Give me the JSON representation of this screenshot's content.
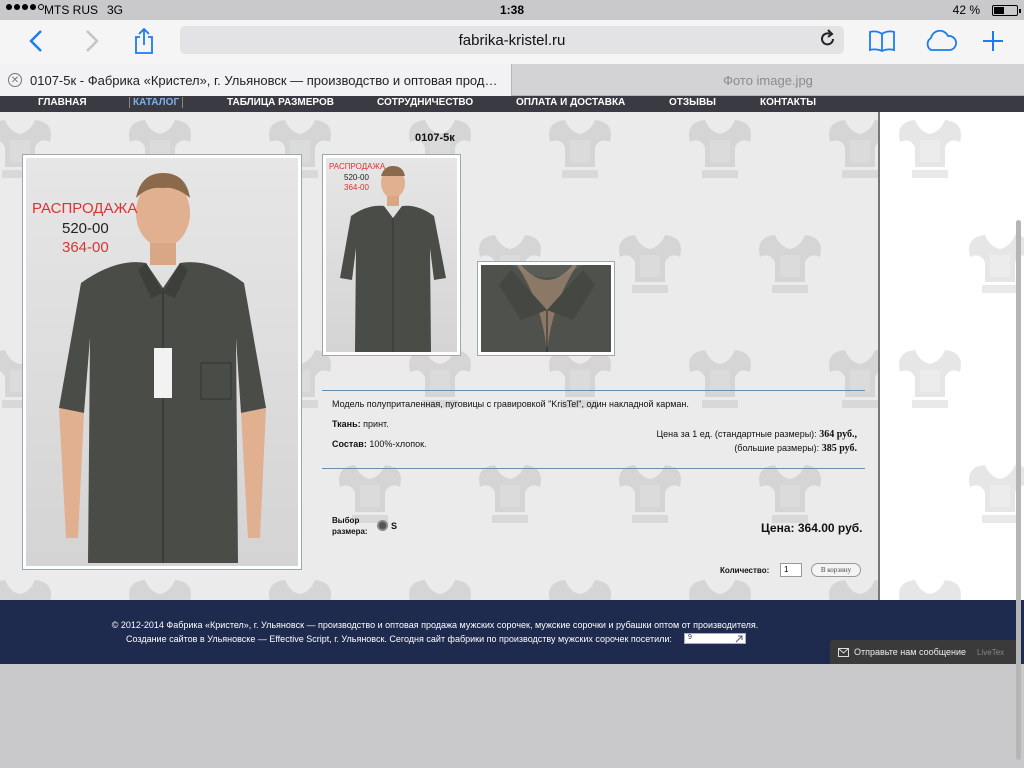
{
  "status": {
    "carrier": "MTS RUS",
    "network": "3G",
    "time": "1:38",
    "battery": "42 %",
    "battery_level": 0.42
  },
  "browser": {
    "url": "fabrika-kristel.ru",
    "tabs": [
      {
        "title": "0107-5к - Фабрика «Кристел», г. Ульяновск — производство и оптовая прод…"
      },
      {
        "title": "Фото image.jpg"
      }
    ]
  },
  "site": {
    "nav": [
      "ГЛАВНАЯ",
      "КАТАЛОГ",
      "ТАБЛИЦА РАЗМЕРОВ",
      "СОТРУДНИЧЕСТВО",
      "ОПЛАТА И ДОСТАВКА",
      "ОТЗЫВЫ",
      "КОНТАКТЫ"
    ],
    "nav_current": "КАТАЛОГ"
  },
  "product": {
    "title": "0107-5к",
    "photo": {
      "sale_label": "РАСПРОДАЖА",
      "old_price": "520-00",
      "new_price": "364-00"
    },
    "description": "Модель полуприталенная, пуговицы с гравировкой \"KrisTel\", один накладной карман.",
    "fabric_label": "Ткань:",
    "fabric_value": "принт.",
    "composition_label": "Состав:",
    "composition_value": "100%-хлопок.",
    "unit_price_label": "Цена за 1 ед. (стандартные размеры):",
    "unit_price_value": "364 руб.,",
    "large_price_label": "(большие размеры):",
    "large_price_value": "385 руб.",
    "size_label_1": "Выбор",
    "size_label_2": "размера:",
    "size_value": "S",
    "total_label": "Цена:",
    "total_value": "364.00 руб.",
    "qty_label": "Количество:",
    "qty_value": "1",
    "cart_button": "В корзину"
  },
  "footer": {
    "line1": "© 2012-2014 Фабрика «Кристел», г. Ульяновск — производство и оптовая продажа мужских сорочек, мужские сорочки и рубашки оптом от производителя.",
    "line2": "Создание сайтов в Ульяновске — Effective Script, г. Ульяновск. Сегодня сайт фабрики по производству мужских сорочек посетили:",
    "counter": "9"
  },
  "chat": {
    "label": "Отправьте нам сообщение",
    "brand": "LiveTex"
  },
  "colors": {
    "ios_blue": "#1a7cf4",
    "footer_bg": "#1e2a4e",
    "nav_bg": "#3a3a42",
    "sale_red": "#d33"
  }
}
